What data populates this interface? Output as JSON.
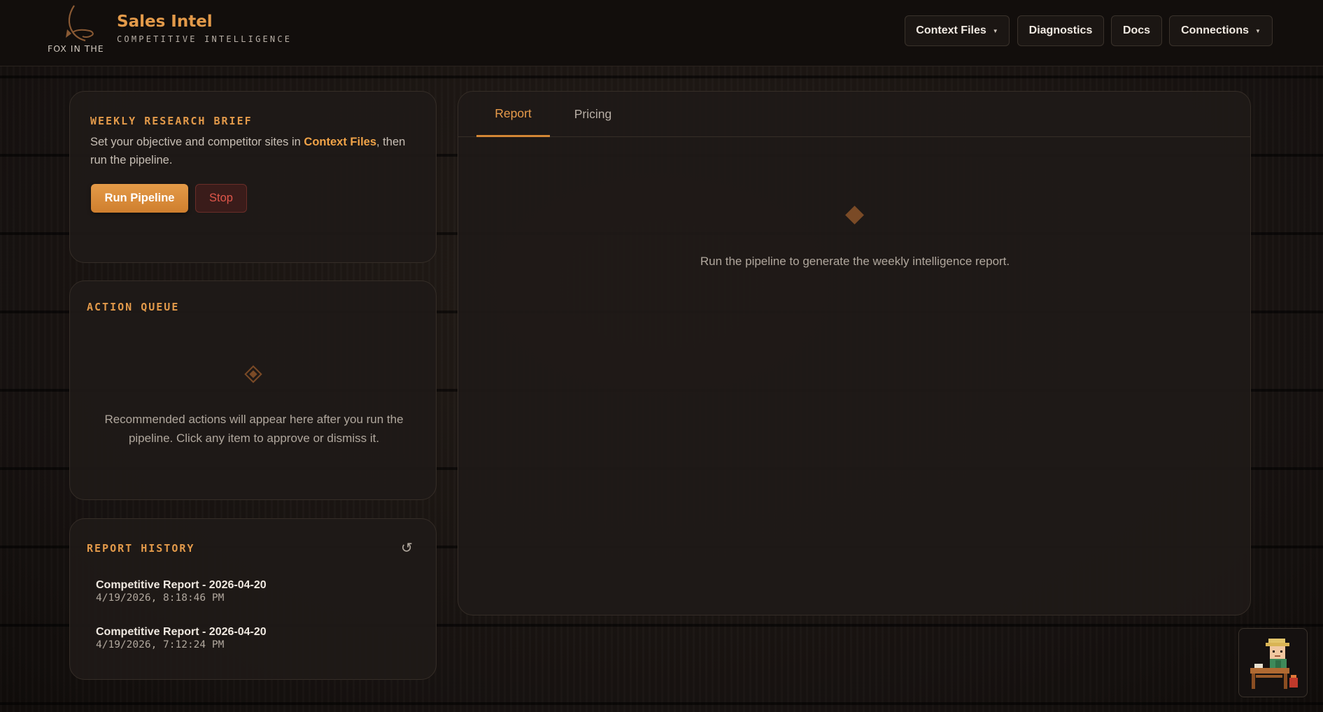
{
  "header": {
    "logo_text": "FOX IN THE",
    "title": "Sales Intel",
    "subtitle": "COMPETITIVE INTELLIGENCE",
    "nav": {
      "context_files": "Context Files",
      "diagnostics": "Diagnostics",
      "docs": "Docs",
      "connections": "Connections"
    }
  },
  "brief": {
    "title": "WEEKLY RESEARCH BRIEF",
    "text_before": "Set your objective and competitor sites in ",
    "link": "Context Files",
    "text_after": ", then run the pipeline.",
    "run_label": "Run Pipeline",
    "stop_label": "Stop"
  },
  "action_queue": {
    "title": "ACTION QUEUE",
    "empty_text": "Recommended actions will appear here after you run the pipeline. Click any item to approve or dismiss it."
  },
  "history": {
    "title": "REPORT HISTORY",
    "items": [
      {
        "title": "Competitive Report - 2026-04-20",
        "time": "4/19/2026, 8:18:46 PM"
      },
      {
        "title": "Competitive Report - 2026-04-20",
        "time": "4/19/2026, 7:12:24 PM"
      }
    ]
  },
  "main": {
    "tabs": [
      {
        "label": "Report",
        "active": true
      },
      {
        "label": "Pricing",
        "active": false
      }
    ],
    "empty_text": "Run the pipeline to generate the weekly intelligence report."
  },
  "colors": {
    "accent": "#e39a4a",
    "background": "#161210",
    "panel": "#1f1a17",
    "stop": "#e0564a"
  },
  "icons": [
    "fox-logo-icon",
    "chevron-down-icon",
    "diamond-icon",
    "refresh-icon",
    "assistant-avatar-icon"
  ]
}
